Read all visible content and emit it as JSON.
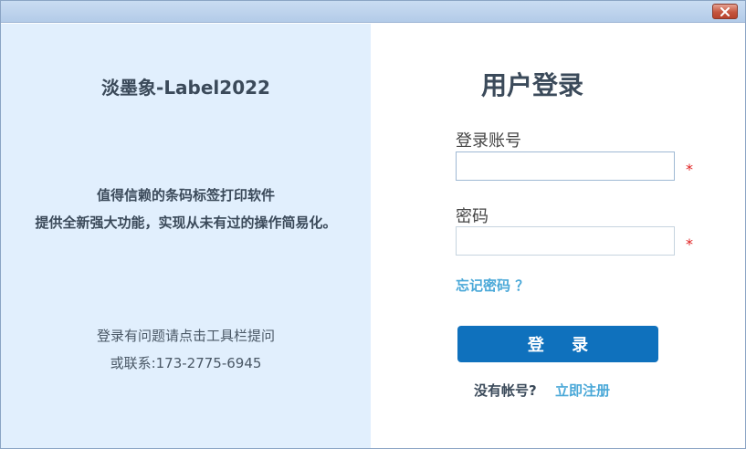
{
  "window": {
    "close_icon": "close-icon"
  },
  "left": {
    "app_title": "淡墨象-Label2022",
    "tagline1": "值得信赖的条码标签打印软件",
    "tagline2": "提供全新强大功能，实现从未有过的操作简易化。",
    "help1": "登录有问题请点击工具栏提问",
    "help2": "或联系:173-2775-6945",
    "background_color": "#e1effd"
  },
  "login": {
    "title": "用户登录",
    "account_label": "登录账号",
    "account_value": "",
    "password_label": "密码",
    "password_value": "",
    "required_mark": "*",
    "forgot_link": "忘记密码 ？",
    "submit_label": "登 录",
    "no_account_text": "没有帐号?",
    "register_link": "立即注册",
    "accent_color": "#0f71bd",
    "link_color": "#4aa8d8",
    "required_color": "#e02020"
  }
}
